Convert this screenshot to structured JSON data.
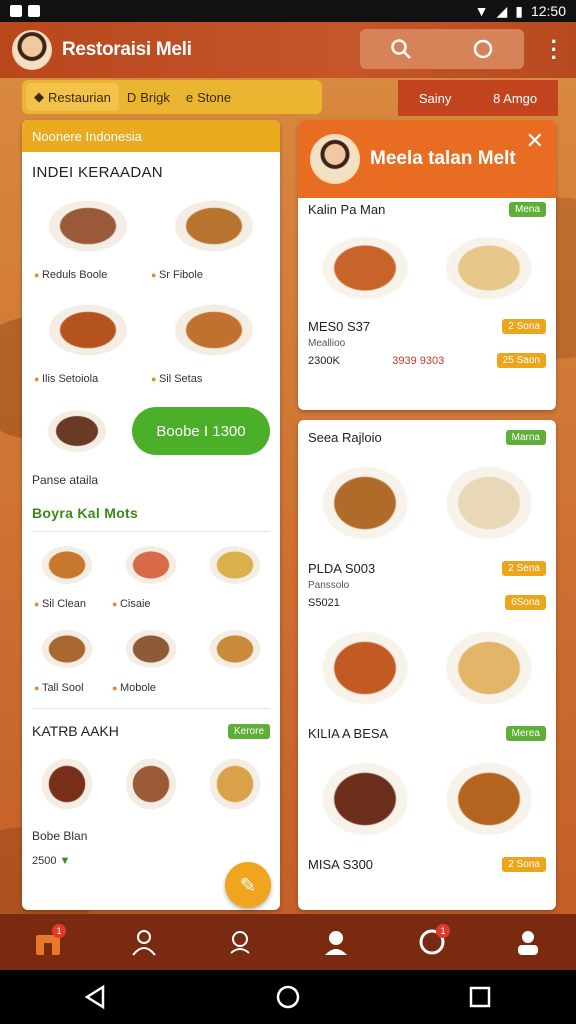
{
  "status": {
    "time": "12:50"
  },
  "app": {
    "title": "Restoraisi Meli"
  },
  "chips": {
    "items": [
      "Restaurian",
      "Brigk",
      "Stone"
    ],
    "right": [
      "Sainy",
      "8 Amgo"
    ]
  },
  "left": {
    "header": "Noonere Indonesia",
    "section1": "INDEI KERAADAN",
    "labels1": [
      "Reduls Boole",
      "Sr Fibole"
    ],
    "labels2": [
      "Ilis Setoiola",
      "Sil Setas"
    ],
    "order_button": "Boobe I 1300",
    "small_note": "Panse ataila",
    "section2": "Boyra Kal Mots",
    "labels3": [
      "Sil Clean",
      "Cisaie"
    ],
    "labels4": [
      "Tall Sool",
      "Mobole"
    ],
    "section3": "KATRB AAKH",
    "section3_badge": "Kerore",
    "footer_name": "Bobe Blan",
    "footer_price": "2500"
  },
  "right": {
    "header_title": "Meela talan Melt",
    "card1_title": "Kalin Pa Man",
    "card1_badge": "Mena",
    "card1_meta": "MES0 S37",
    "card1_meta_badge": "2 Sona",
    "card1_sub": "Meallioo",
    "card1_price": "2300K",
    "card1_price2": "3939 9303",
    "card1_price_badge": "25 Saon",
    "card2_title": "Seea Rajloio",
    "card2_badge": "Marna",
    "card2_meta": "PLDA S003",
    "card2_meta_badge": "2 Sena",
    "card2_sub": "Panssolo",
    "card2_price": "S5021",
    "card2_price_badge": "6Sona",
    "card3_title": "KILIA A BESA",
    "card3_badge": "Merea",
    "card3_meta": "MISA S300",
    "card3_meta_badge": "2 Sona"
  },
  "nav": {
    "badge_home": "1",
    "badge_notify": "1"
  },
  "colors": {
    "accent": "#e86c22",
    "green": "#4caf2a",
    "gold": "#eab530"
  }
}
